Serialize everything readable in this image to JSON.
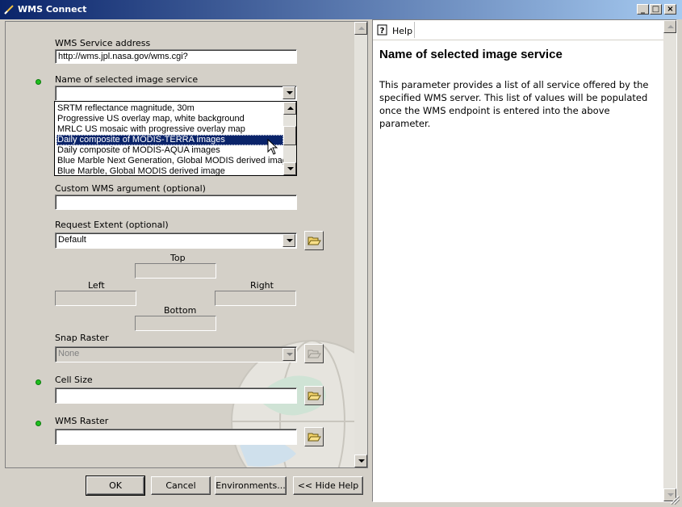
{
  "window": {
    "title": "WMS Connect",
    "controls": {
      "minimize": "_",
      "maximize": "□",
      "close": "×"
    }
  },
  "form": {
    "wms_service_address": {
      "label": "WMS Service address",
      "value": "http://wms.jpl.nasa.gov/wms.cgi?"
    },
    "image_service": {
      "label": "Name of selected image service",
      "value": "",
      "options": [
        "SRTM reflectance magnitude, 30m",
        "Progressive US overlay map, white background",
        "MRLC US mosaic with progressive overlay map",
        "Daily composite of MODIS-TERRA images",
        "Daily composite of MODIS-AQUA images",
        "Blue Marble Next Generation, Global MODIS derived image",
        "Blue Marble, Global MODIS derived image"
      ],
      "highlighted_option": "Daily composite of MODIS-TERRA images"
    },
    "custom_argument": {
      "label": "Custom WMS argument (optional)",
      "value": ""
    },
    "request_extent": {
      "label": "Request Extent (optional)",
      "value": "Default",
      "top_label": "Top",
      "left_label": "Left",
      "right_label": "Right",
      "bottom_label": "Bottom"
    },
    "snap_raster": {
      "label": "Snap Raster",
      "value": "None"
    },
    "cell_size": {
      "label": "Cell Size",
      "value": ""
    },
    "wms_raster": {
      "label": "WMS Raster",
      "value": ""
    }
  },
  "buttons": {
    "ok": "OK",
    "cancel": "Cancel",
    "environments": "Environments...",
    "hide_help": "<< Hide Help"
  },
  "help": {
    "toolbar_label": "Help",
    "title": "Name of selected image service",
    "body": "This parameter provides a list of all service offered by the specified WMS server. This list of values will be populated once the WMS endpoint is entered into the above parameter."
  },
  "colors": {
    "titlebar_start": "#0a246a",
    "titlebar_end": "#a6caf0",
    "selection": "#0a246a",
    "required_dot": "#1fbf1f",
    "dialog_bg": "#d4d0c8"
  }
}
